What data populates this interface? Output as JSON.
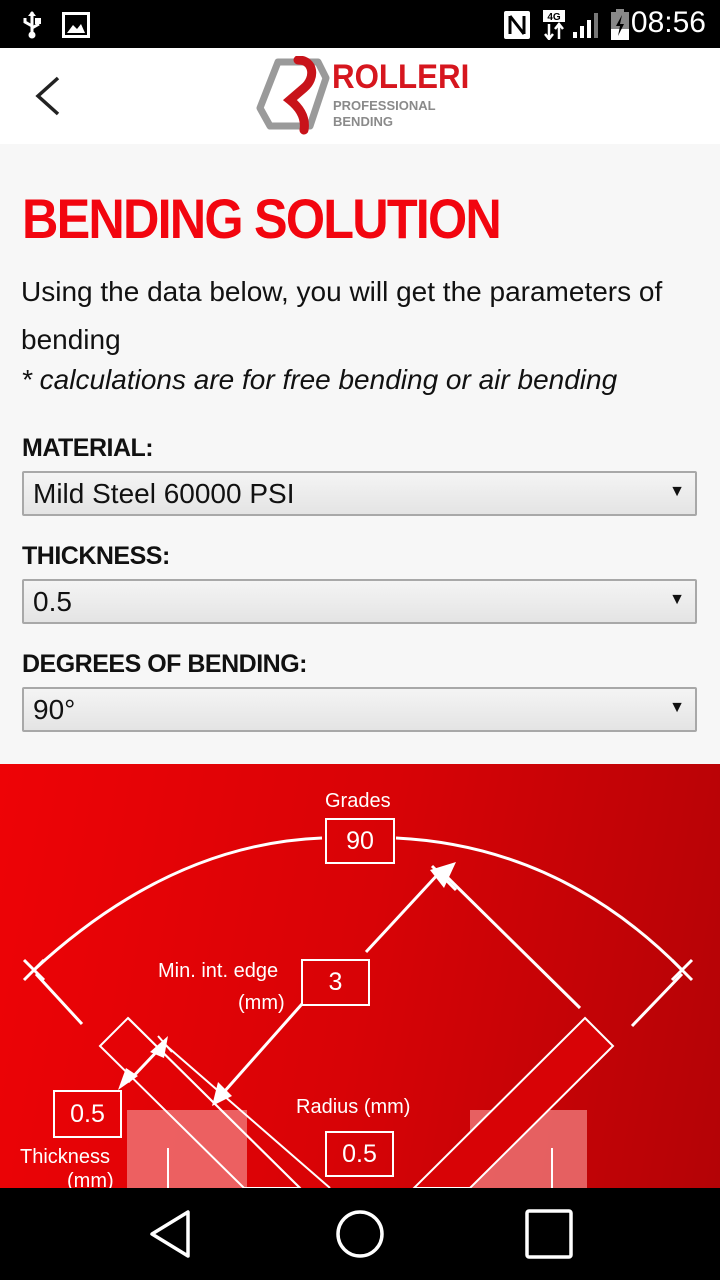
{
  "status_bar": {
    "time": "08:56",
    "icons": [
      "usb-icon",
      "image-icon",
      "nfc-icon",
      "4g-data-icon",
      "signal-icon",
      "battery-charging-icon"
    ],
    "network": "4G"
  },
  "app_bar": {
    "back_icon": "chevron-left-icon",
    "logo": {
      "brand": "ROLLERI",
      "tagline_1": "PROFESSIONAL",
      "tagline_2": "BENDING"
    }
  },
  "page": {
    "title": "BENDING SOLUTION",
    "intro": "Using the data below, you will get the parameters of bending",
    "note": "* calculations are for free bending or air bending"
  },
  "form": {
    "material": {
      "label": "MATERIAL:",
      "value": "Mild Steel 60000 PSI"
    },
    "thickness": {
      "label": "THICKNESS:",
      "value": "0.5"
    },
    "degrees": {
      "label": "DEGREES OF BENDING:",
      "value": "90°"
    }
  },
  "diagram": {
    "grades": {
      "label": "Grades",
      "value": "90"
    },
    "min_int_edge": {
      "label_1": "Min. int. edge",
      "label_2": "(mm)",
      "value": "3"
    },
    "thickness": {
      "label_1": "Thickness",
      "label_2": "(mm)",
      "value": "0.5"
    },
    "radius": {
      "label": "Radius (mm)",
      "value": "0.5"
    }
  },
  "colors": {
    "brand_red": "#d6161e",
    "title_red": "#f2050f",
    "diagram_red": "#d80306"
  },
  "nav_bar": {
    "buttons": [
      "back-icon",
      "home-icon",
      "recents-icon"
    ]
  }
}
